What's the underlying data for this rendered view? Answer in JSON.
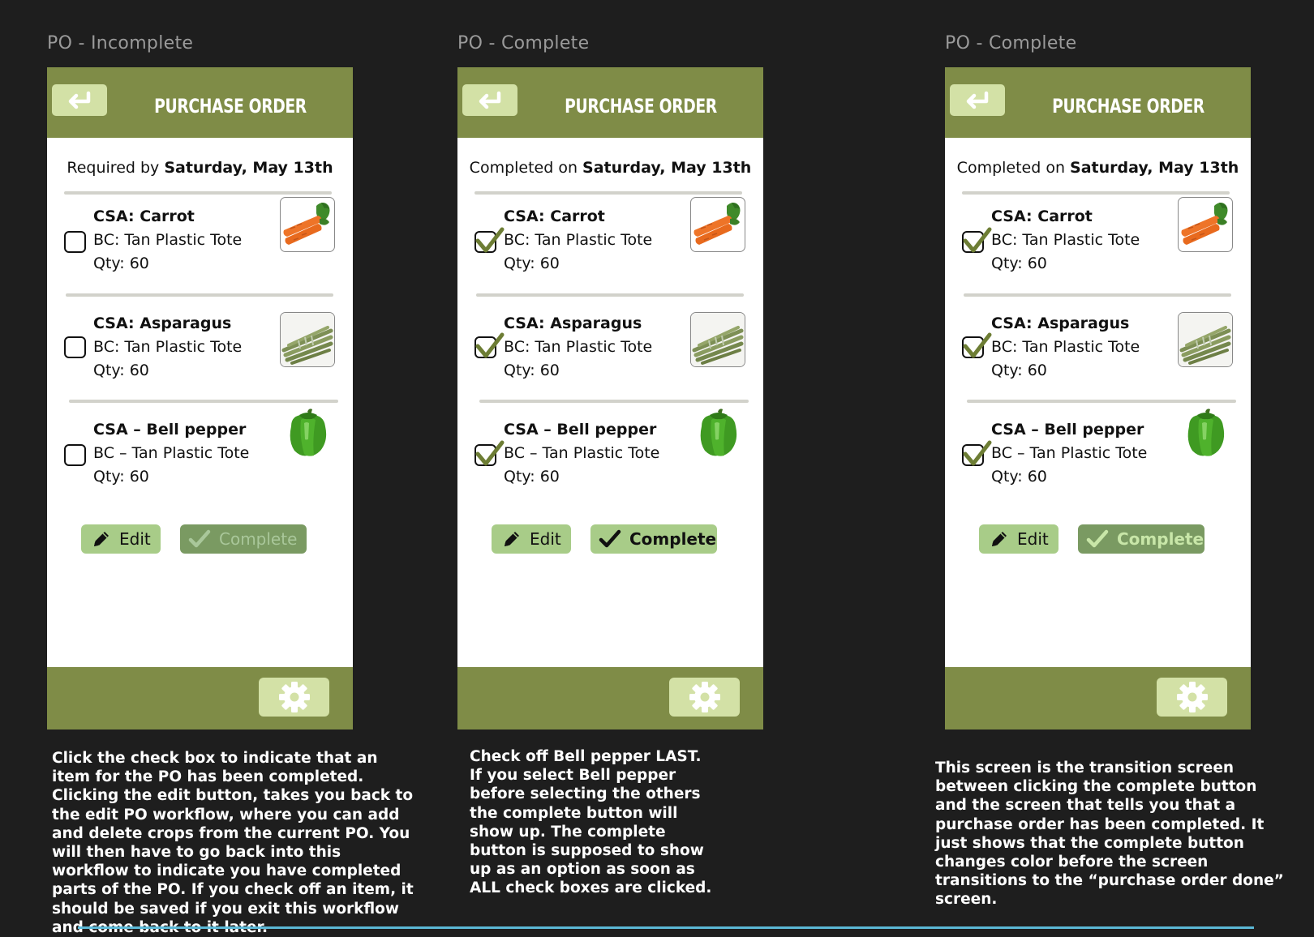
{
  "colors": {
    "background": "#1e1e1e",
    "header_green": "#7f8c47",
    "light_green": "#d3e1a6",
    "button_green": "#a8cc88",
    "complete_disabled": "#7a9a62",
    "complete_active": "#a8cc88",
    "complete_transition": "#7a9a62",
    "check_green": "#6d7d34"
  },
  "icons": {
    "back": "return-arrow-icon",
    "gear": "gear-icon",
    "edit": "pencil-icon",
    "complete": "checkmark-icon"
  },
  "screens": [
    {
      "frame_label": "PO - Incomplete",
      "header_title": "PURCHASE ORDER",
      "date_prefix": "Required by ",
      "date_value": "Saturday, May 13th",
      "items": [
        {
          "name": "CSA: Carrot",
          "bc": "BC:  Tan Plastic Tote",
          "qty": "Qty: 60",
          "checked": false,
          "image": "carrot"
        },
        {
          "name": "CSA: Asparagus",
          "bc": "BC:  Tan Plastic Tote",
          "qty": "Qty: 60",
          "checked": false,
          "image": "asparagus"
        },
        {
          "name": "CSA – Bell pepper",
          "bc": "BC – Tan Plastic Tote",
          "qty": "Qty: 60",
          "checked": false,
          "image": "bell-pepper"
        }
      ],
      "edit_label": "Edit",
      "complete_label": "Complete",
      "complete_state": "disabled",
      "note": "Click the check box to indicate that an item for the PO has been completed.  Clicking the edit button, takes you back to the edit PO workflow, where you can add and delete crops from the current PO.  You will then have to go back into this workflow to indicate you have completed parts of the PO. If you check off an item, it should be saved if you exit this workflow and come back to it later."
    },
    {
      "frame_label": "PO - Complete",
      "header_title": "PURCHASE ORDER",
      "date_prefix": "Completed on ",
      "date_value": "Saturday, May 13th",
      "items": [
        {
          "name": "CSA: Carrot",
          "bc": "BC:  Tan Plastic Tote",
          "qty": "Qty: 60",
          "checked": true,
          "image": "carrot"
        },
        {
          "name": "CSA: Asparagus",
          "bc": "BC:  Tan Plastic Tote",
          "qty": "Qty: 60",
          "checked": true,
          "image": "asparagus"
        },
        {
          "name": "CSA – Bell pepper",
          "bc": "BC – Tan Plastic Tote",
          "qty": "Qty: 60",
          "checked": true,
          "image": "bell-pepper"
        }
      ],
      "edit_label": "Edit",
      "complete_label": "Complete",
      "complete_state": "active",
      "note": "Check off Bell pepper LAST. If you select Bell pepper before selecting the others the complete button will show up. The complete button is supposed to show up as an option as soon as ALL check boxes are clicked."
    },
    {
      "frame_label": "PO - Complete",
      "header_title": "PURCHASE ORDER",
      "date_prefix": "Completed on ",
      "date_value": "Saturday, May 13th",
      "items": [
        {
          "name": "CSA: Carrot",
          "bc": "BC:  Tan Plastic Tote",
          "qty": "Qty: 60",
          "checked": true,
          "image": "carrot"
        },
        {
          "name": "CSA: Asparagus",
          "bc": "BC:  Tan Plastic Tote",
          "qty": "Qty: 60",
          "checked": true,
          "image": "asparagus"
        },
        {
          "name": "CSA – Bell pepper",
          "bc": "BC – Tan Plastic Tote",
          "qty": "Qty: 60",
          "checked": true,
          "image": "bell-pepper"
        }
      ],
      "edit_label": "Edit",
      "complete_label": "Complete",
      "complete_state": "transition",
      "note": "This screen is the transition screen between clicking the complete button and the screen that tells you that a purchase order has been completed. It just shows that the complete button changes color before the screen transitions to the “purchase order done” screen."
    }
  ]
}
